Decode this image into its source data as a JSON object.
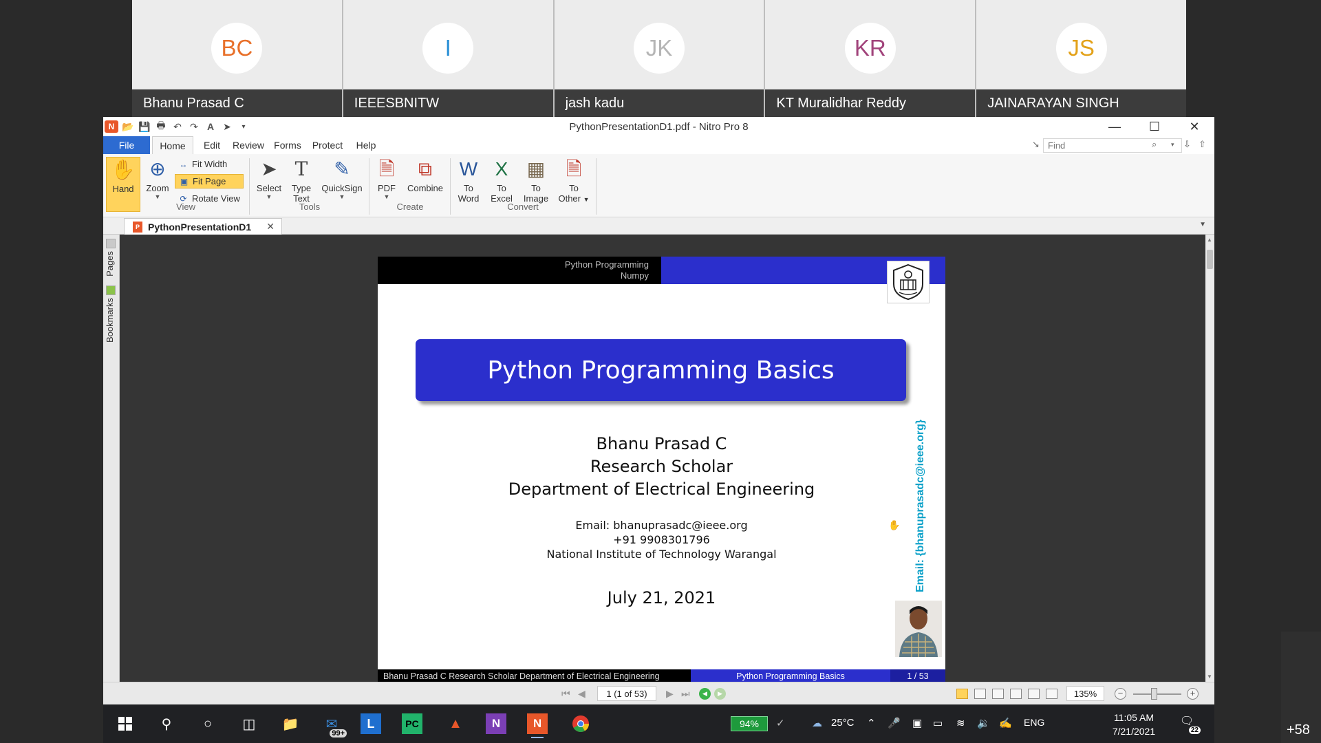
{
  "participants": [
    {
      "initials": "BC",
      "name": "Bhanu Prasad C",
      "color": "#e8702a"
    },
    {
      "initials": "I",
      "name": "IEEESBNITW",
      "color": "#2a8fd6"
    },
    {
      "initials": "JK",
      "name": "jash kadu",
      "color": "#b5b5b5"
    },
    {
      "initials": "KR",
      "name": "KT Muralidhar Reddy",
      "color": "#a1437b"
    },
    {
      "initials": "JS",
      "name": "JAINARAYAN SINGH",
      "color": "#e3a21a"
    }
  ],
  "more_participants": "+58",
  "window": {
    "title": "PythonPresentationD1.pdf - Nitro Pro 8"
  },
  "menu": {
    "file": "File",
    "home": "Home",
    "edit": "Edit",
    "review": "Review",
    "forms": "Forms",
    "protect": "Protect",
    "help": "Help"
  },
  "find": {
    "placeholder": "Find"
  },
  "ribbon": {
    "hand": "Hand",
    "zoom": "Zoom",
    "fit_width": "Fit Width",
    "fit_page": "Fit Page",
    "rotate_view": "Rotate View",
    "select": "Select",
    "type_text_1": "Type",
    "type_text_2": "Text",
    "quicksign": "QuickSign",
    "pdf": "PDF",
    "combine": "Combine",
    "to": "To",
    "word": "Word",
    "excel": "Excel",
    "image": "Image",
    "other": "Other",
    "groups": {
      "view": "View",
      "tools": "Tools",
      "create": "Create",
      "convert": "Convert"
    }
  },
  "document_tab": {
    "name": "PythonPresentationD1"
  },
  "side_panel": {
    "pages": "Pages",
    "bookmarks": "Bookmarks"
  },
  "slide": {
    "header_line1": "Python Programming",
    "header_line2": "Numpy",
    "title": "Python Programming Basics",
    "author": "Bhanu Prasad C",
    "role": "Research Scholar",
    "department": "Department of Electrical Engineering",
    "email": "Email:  bhanuprasadc@ieee.org",
    "phone": "+91 9908301796",
    "institute": "National Institute of Technology Warangal",
    "date": "July 21, 2021",
    "vertical_email": "Email: {bhanuprasadc@ieee.org}",
    "footer_left": "Bhanu Prasad C  Research Scholar Department of Electrical Engineering",
    "footer_mid": "Python Programming Basics",
    "footer_right": "1 / 53"
  },
  "status": {
    "page": "1 (1 of 53)",
    "zoom": "135%"
  },
  "taskbar": {
    "mail_badge": "99+",
    "battery": "94%",
    "temperature": "25°C",
    "language": "ENG",
    "time": "11:05 AM",
    "date": "7/21/2021",
    "notifications": "22"
  }
}
